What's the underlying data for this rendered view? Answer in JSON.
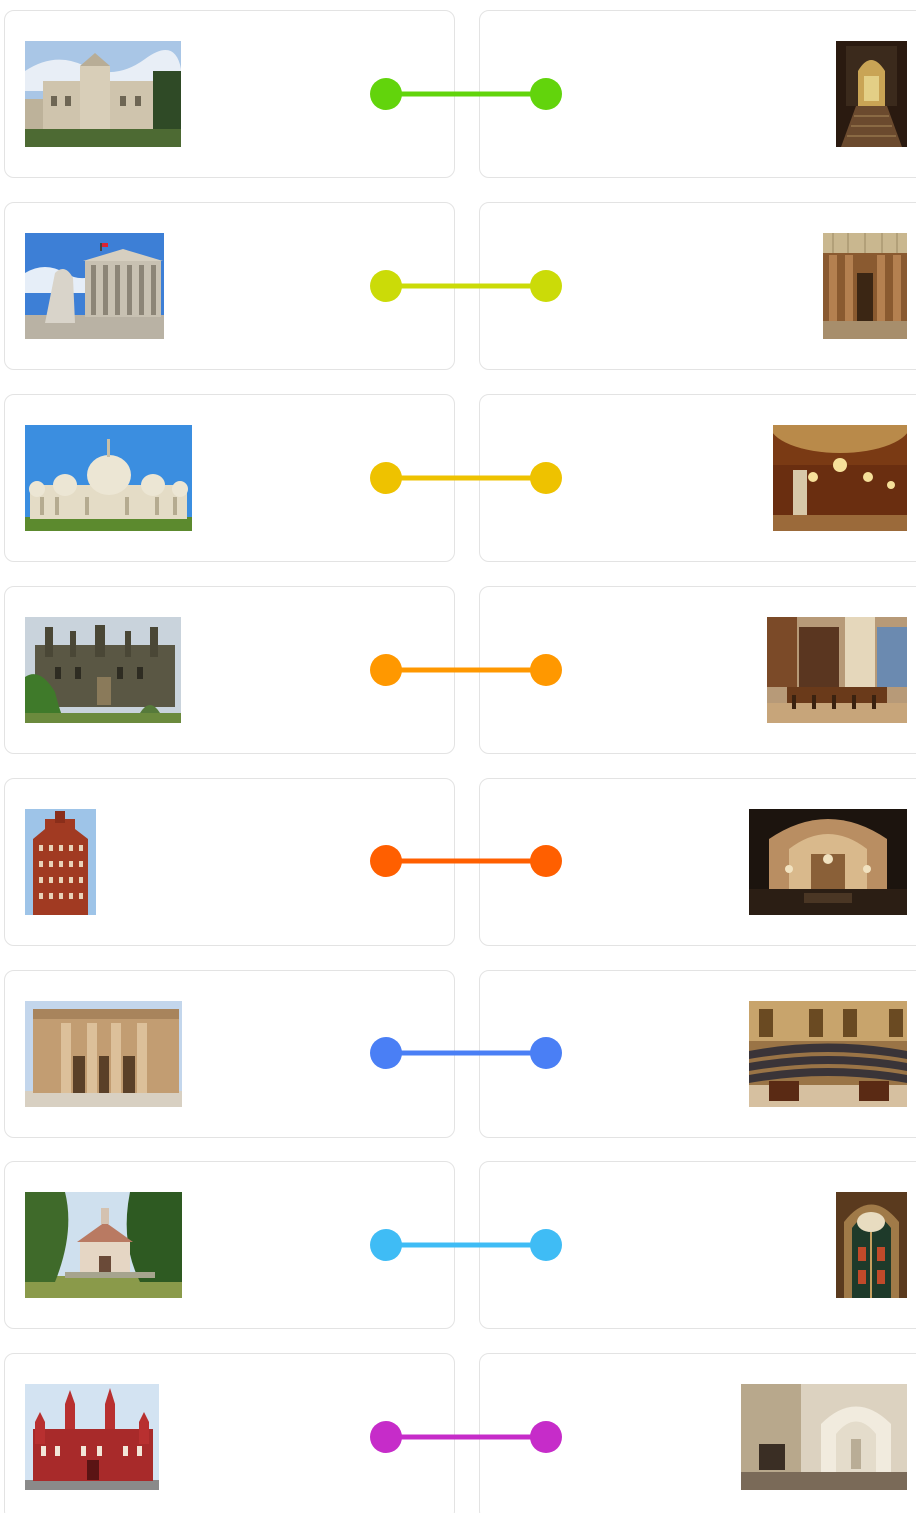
{
  "pairs": [
    {
      "left": {
        "icon": "castle-exterior-photo"
      },
      "right": {
        "icon": "ornate-staircase-interior-photo"
      },
      "color": "#62d40c"
    },
    {
      "left": {
        "icon": "parliament-colonnade-photo"
      },
      "right": {
        "icon": "columned-hall-interior-photo"
      },
      "color": "#cbdb08"
    },
    {
      "left": {
        "icon": "domed-pavilion-exterior-photo"
      },
      "right": {
        "icon": "chandelier-hall-interior-photo"
      },
      "color": "#eec200"
    },
    {
      "left": {
        "icon": "gothic-palace-exterior-photo"
      },
      "right": {
        "icon": "dining-hall-interior-photo"
      },
      "color": "#ff9800"
    },
    {
      "left": {
        "icon": "brick-tower-exterior-photo"
      },
      "right": {
        "icon": "arched-reading-room-interior-photo"
      },
      "color": "#ff5f00"
    },
    {
      "left": {
        "icon": "egyptian-temple-facade-photo"
      },
      "right": {
        "icon": "assembly-chamber-interior-photo"
      },
      "color": "#4a7ff5"
    },
    {
      "left": {
        "icon": "park-pavilion-exterior-photo"
      },
      "right": {
        "icon": "ornate-doorway-interior-photo"
      },
      "color": "#3fbcf5"
    },
    {
      "left": {
        "icon": "red-brick-museum-exterior-photo"
      },
      "right": {
        "icon": "carved-arch-room-interior-photo"
      },
      "color": "#c62cc9"
    }
  ]
}
